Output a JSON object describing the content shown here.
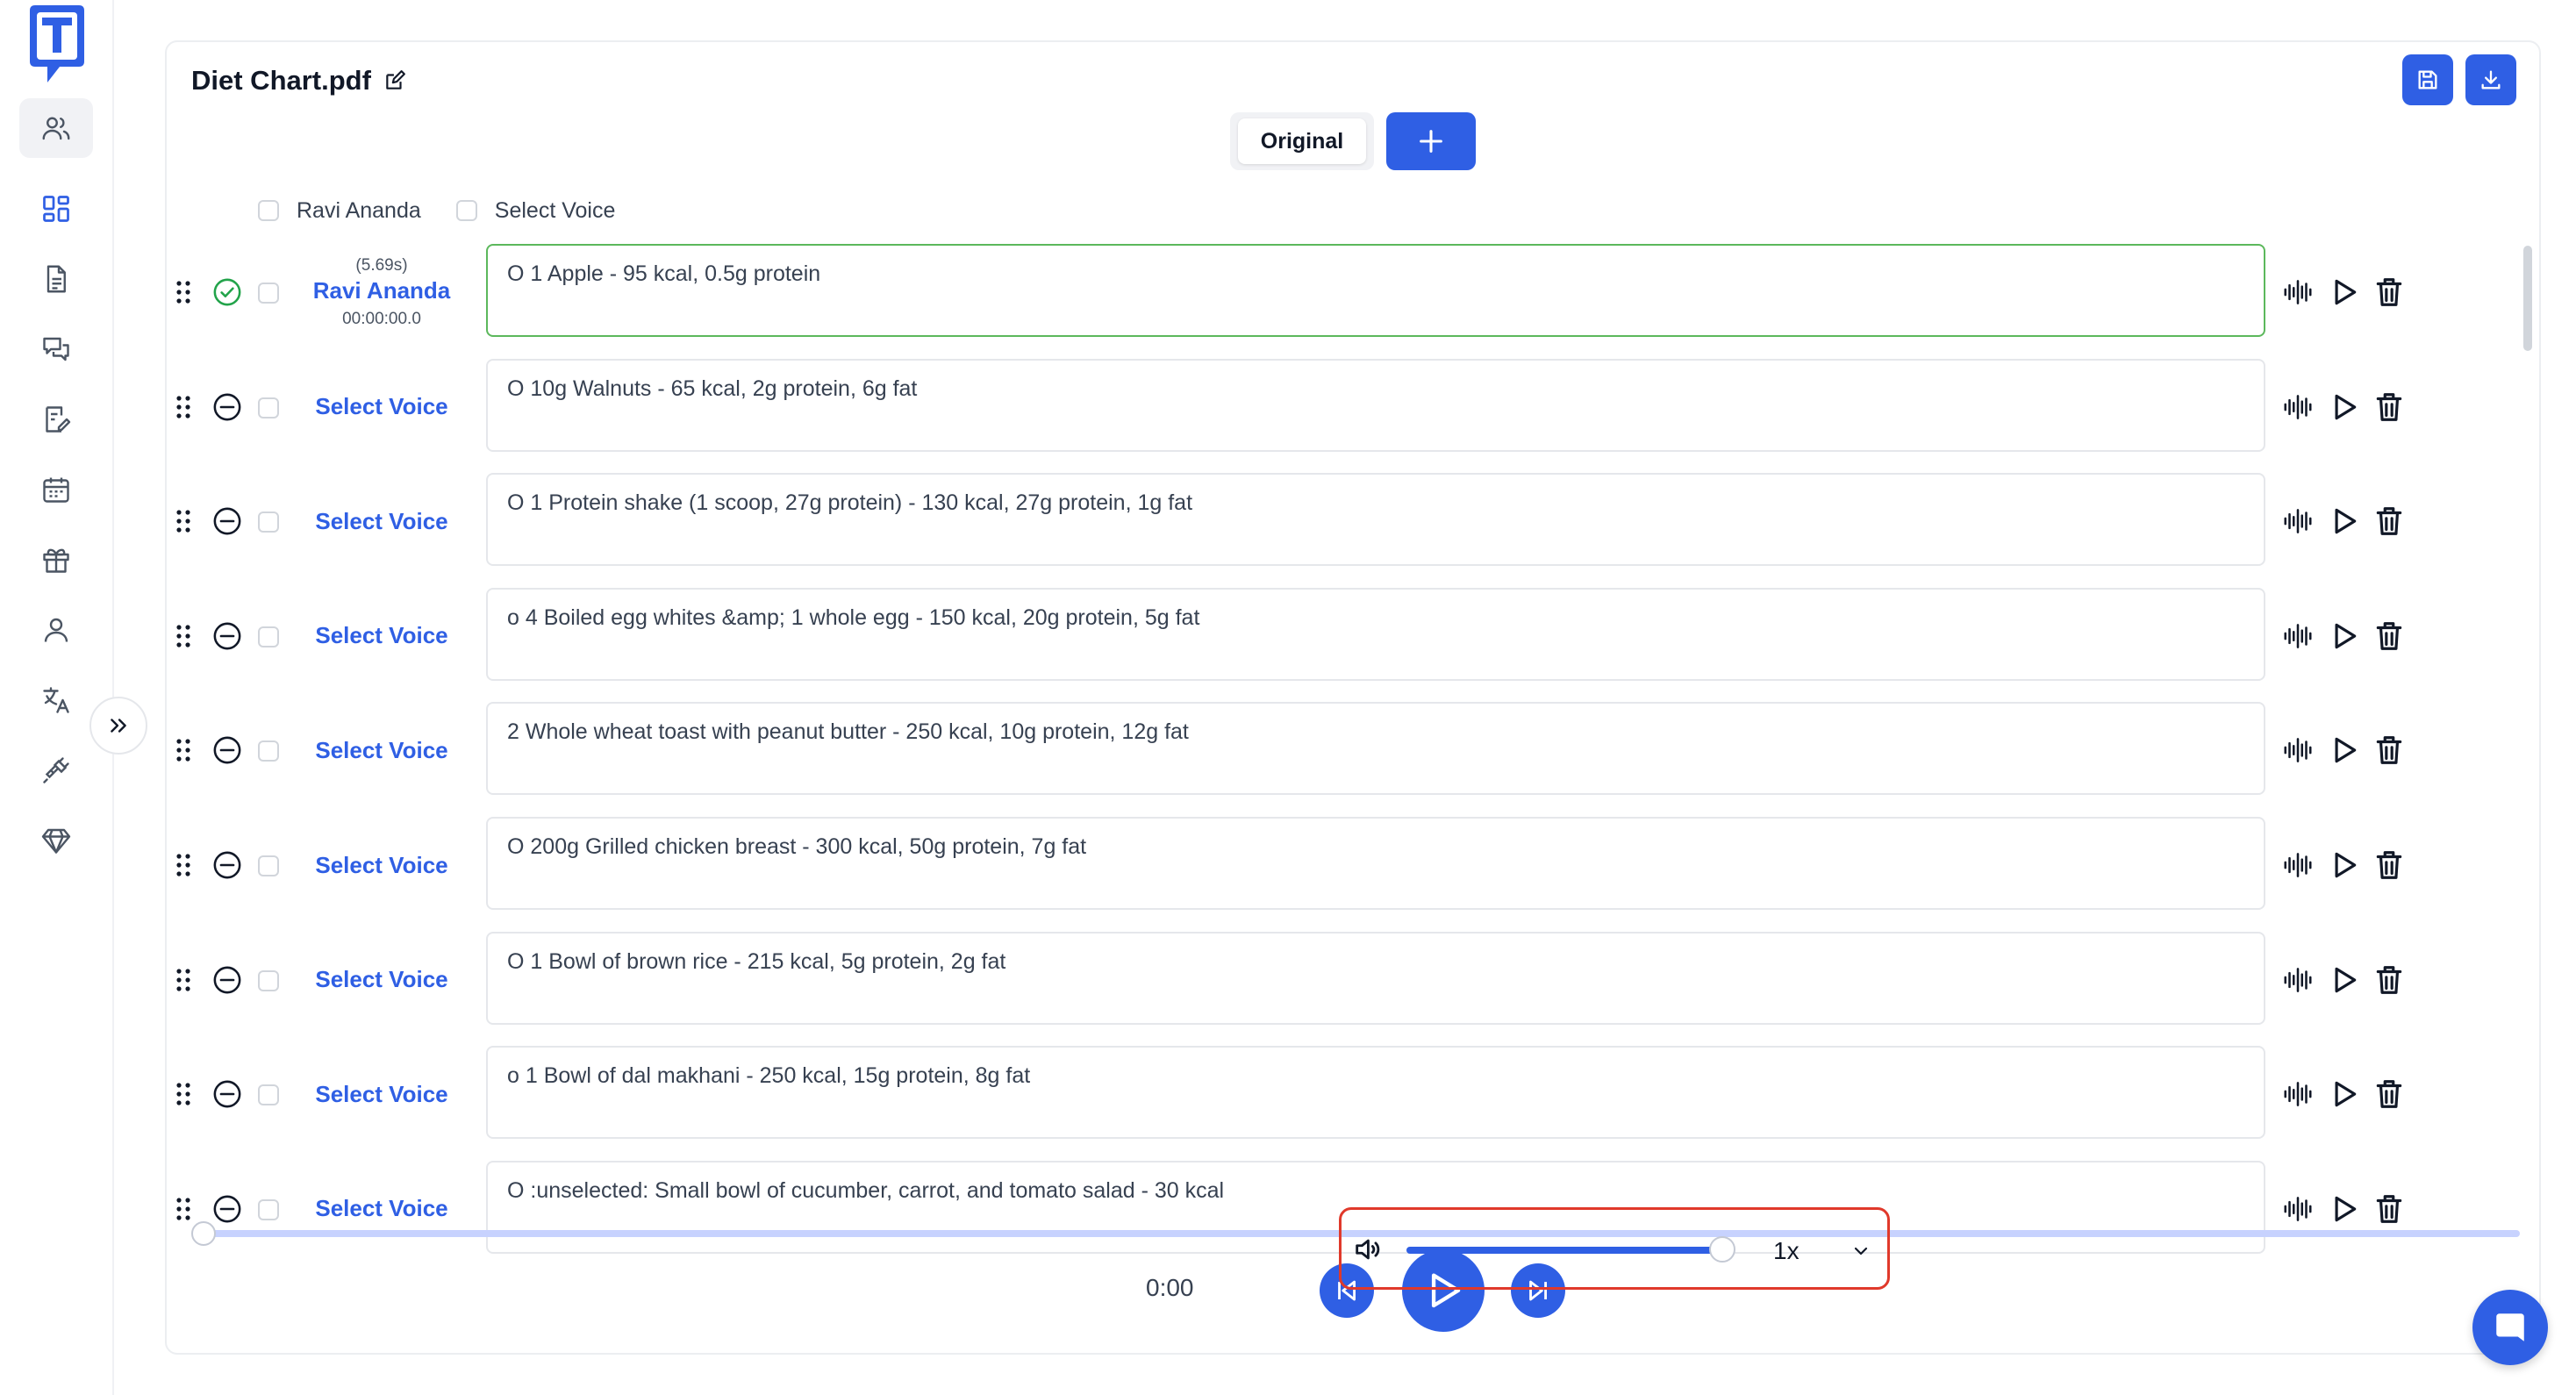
{
  "colors": {
    "accent": "#2f5fe4",
    "active_border": "#5cb85c",
    "highlight": "#e0392b",
    "seek_track": "#c7d2fe"
  },
  "sidebar": {
    "logo_icon": "t-logo-icon",
    "items": [
      {
        "icon": "users-icon",
        "active": true
      },
      {
        "icon": "dashboard-icon",
        "active": false
      },
      {
        "icon": "document-icon",
        "active": false
      },
      {
        "icon": "chat-icon",
        "active": false
      },
      {
        "icon": "edit-note-icon",
        "active": false
      },
      {
        "icon": "calendar-icon",
        "active": false
      },
      {
        "icon": "gift-icon",
        "active": false
      },
      {
        "icon": "user-icon",
        "active": false
      },
      {
        "icon": "translate-icon",
        "active": false
      },
      {
        "icon": "plug-icon",
        "active": false
      },
      {
        "icon": "diamond-icon",
        "active": false
      }
    ],
    "collapse_icon": "chevrons-right-icon"
  },
  "document": {
    "title": "Diet Chart.pdf"
  },
  "toolbar": {
    "save_icon": "save-icon",
    "download_icon": "download-icon"
  },
  "tabs": {
    "original": "Original",
    "add_icon": "plus-icon"
  },
  "filters": {
    "speaker": "Ravi Ananda",
    "voice": "Select Voice"
  },
  "rows": [
    {
      "duration": "(5.69s)",
      "voice": "Ravi Ananda",
      "timecode": "00:00:00.0",
      "text": "O 1 Apple - 95 kcal, 0.5g protein",
      "status": "done",
      "active": true
    },
    {
      "voice": "Select Voice",
      "text": "O 10g Walnuts - 65 kcal, 2g protein, 6g fat",
      "status": "pending"
    },
    {
      "voice": "Select Voice",
      "text": "O 1 Protein shake (1 scoop, 27g protein) - 130 kcal, 27g protein, 1g fat",
      "status": "pending"
    },
    {
      "voice": "Select Voice",
      "text": "o 4 Boiled egg whites &amp; 1 whole egg - 150 kcal, 20g protein, 5g fat",
      "status": "pending"
    },
    {
      "voice": "Select Voice",
      "text": "2 Whole wheat toast with peanut butter - 250 kcal, 10g protein, 12g fat",
      "status": "pending"
    },
    {
      "voice": "Select Voice",
      "text": "O 200g Grilled chicken breast - 300 kcal, 50g protein, 7g fat",
      "status": "pending"
    },
    {
      "voice": "Select Voice",
      "text": "O 1 Bowl of brown rice - 215 kcal, 5g protein, 2g fat",
      "status": "pending"
    },
    {
      "voice": "Select Voice",
      "text": "o 1 Bowl of dal makhani - 250 kcal, 15g protein, 8g fat",
      "status": "pending"
    },
    {
      "voice": "Select Voice",
      "text": "O :unselected: Small bowl of cucumber, carrot, and tomato salad - 30 kcal",
      "status": "pending"
    }
  ],
  "player": {
    "current_time": "0:00",
    "seek_progress": 0,
    "volume": 1.0,
    "speed": "1x",
    "icons": {
      "prev": "skip-back-icon",
      "play": "play-icon",
      "next": "skip-forward-icon",
      "volume": "volume-icon",
      "speed_dropdown": "chevron-down-icon"
    }
  },
  "chat": {
    "icon": "chat-bubble-icon"
  }
}
